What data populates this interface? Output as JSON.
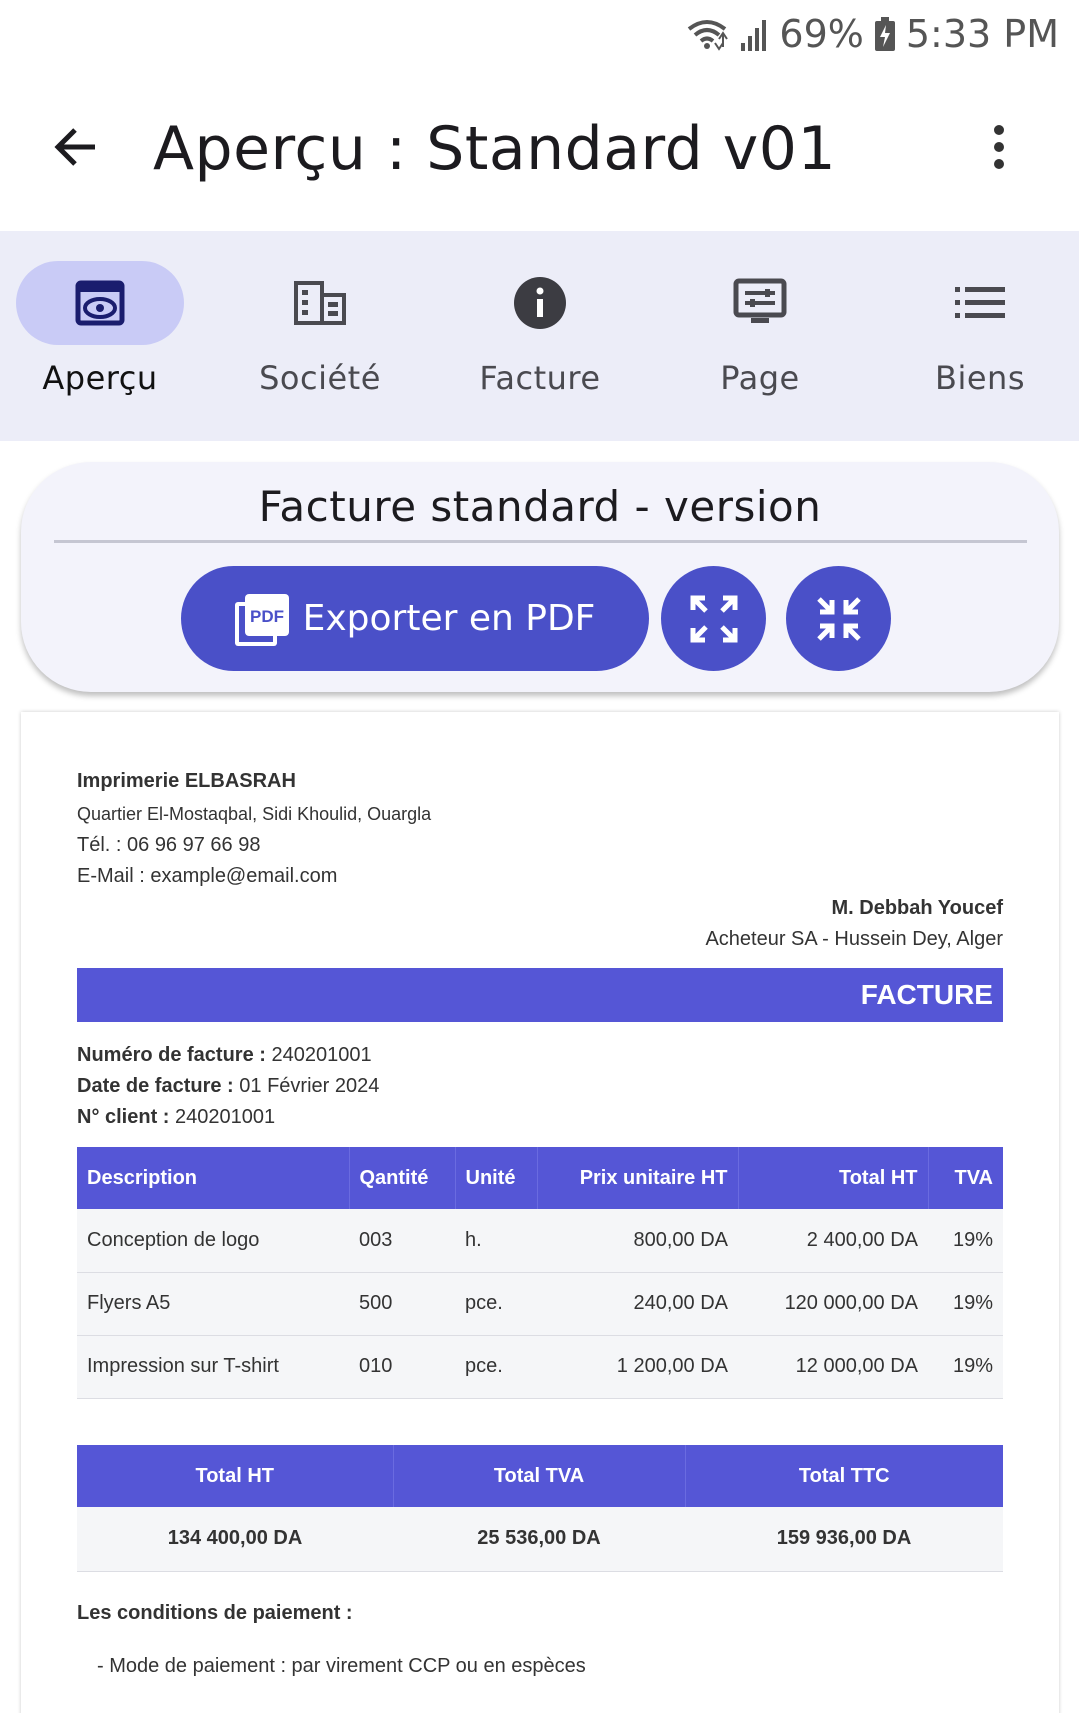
{
  "status": {
    "battery": "69%",
    "time": "5:33 PM"
  },
  "appbar": {
    "title": "Aperçu : Standard v01"
  },
  "tabs": [
    {
      "label": "Aperçu",
      "icon": "eye-icon"
    },
    {
      "label": "Société",
      "icon": "building-icon"
    },
    {
      "label": "Facture",
      "icon": "info-icon"
    },
    {
      "label": "Page",
      "icon": "settings-display-icon"
    },
    {
      "label": "Biens",
      "icon": "list-icon"
    }
  ],
  "card": {
    "title": "Facture standard - version",
    "export_label": "Exporter en PDF"
  },
  "doc": {
    "company": {
      "name": "Imprimerie ELBASRAH",
      "address": "Quartier El-Mostaqbal, Sidi Khoulid, Ouargla",
      "tel": "Tél. : 06 96 97 66 98",
      "email": "E-Mail : example@email.com"
    },
    "client": {
      "name": "M. Debbah Youcef",
      "address": "Acheteur SA - Hussein Dey, Alger"
    },
    "banner": "FACTURE",
    "meta": [
      {
        "label": "Numéro de facture :",
        "value": "240201001"
      },
      {
        "label": "Date de facture :",
        "value": "01 Février 2024"
      },
      {
        "label": "N° client :",
        "value": "240201001"
      }
    ],
    "items_headers": [
      "Description",
      "Qantité",
      "Unité",
      "Prix unitaire HT",
      "Total HT",
      "TVA"
    ],
    "items": [
      [
        "Conception de logo",
        "003",
        "h.",
        "800,00 DA",
        "2 400,00 DA",
        "19%"
      ],
      [
        "Flyers A5",
        "500",
        "pce.",
        "240,00 DA",
        "120 000,00 DA",
        "19%"
      ],
      [
        "Impression sur T-shirt",
        "010",
        "pce.",
        "1 200,00 DA",
        "12 000,00 DA",
        "19%"
      ]
    ],
    "totals_headers": [
      "Total HT",
      "Total TVA",
      "Total TTC"
    ],
    "totals": [
      "134 400,00 DA",
      "25 536,00 DA",
      "159 936,00 DA"
    ],
    "conditions_title": "Les conditions de paiement :",
    "conditions": [
      "-  Mode de paiement : par virement CCP ou en espèces"
    ]
  }
}
